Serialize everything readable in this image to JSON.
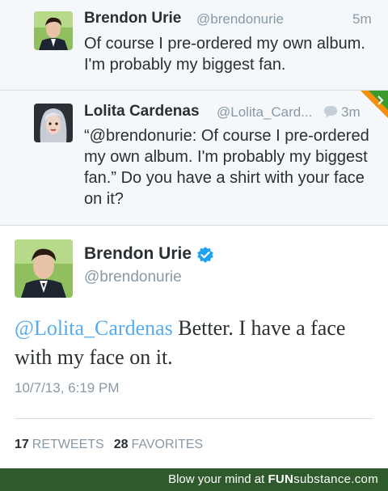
{
  "tweets": [
    {
      "name": "Brendon Urie",
      "handle": "@brendonurie",
      "time": "5m",
      "text": "Of course I pre-ordered my own album. I'm probably my biggest fan."
    },
    {
      "name": "Lolita Cardenas",
      "handle": "@Lolita_Card...",
      "time": "3m",
      "text": "“@brendonurie: Of course I pre-ordered my own album. I'm probably my biggest fan.” Do you have a shirt with your face on it?"
    }
  ],
  "main": {
    "name": "Brendon Urie",
    "handle": "@brendonurie",
    "mention": "@Lolita_Cardenas",
    "text": " Better. I have a face with my face on it.",
    "timestamp": "10/7/13, 6:19 PM",
    "retweets_count": "17",
    "retweets_label": "RETWEETS",
    "favorites_count": "28",
    "favorites_label": "FAVORITES"
  },
  "footer": {
    "text": "Blow your mind at",
    "brand_fun": "FUN",
    "brand_sub": "substance",
    "brand_com": ".com"
  },
  "colors": {
    "link": "#55acee",
    "muted": "#8899a6",
    "footer_bg": "#2f5a2b",
    "verified": "#1da1f2"
  },
  "icons": [
    "conversation-icon",
    "verified-badge-icon",
    "retweet-corner-badge-icon"
  ]
}
